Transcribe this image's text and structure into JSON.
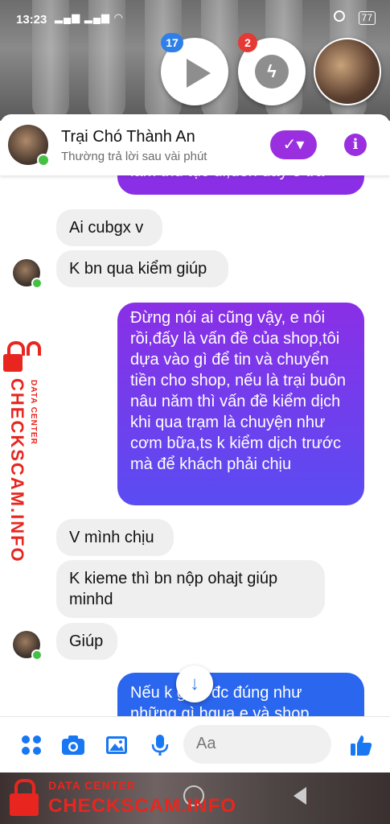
{
  "status_bar": {
    "time": "13:23",
    "battery": "77"
  },
  "chat_heads": {
    "video_badge": "17",
    "messenger_badge": "2"
  },
  "header": {
    "name": "Trại Chó Thành An",
    "subtitle": "Thường trả lời sau vài phút",
    "check_icon": "✓▾",
    "info_icon": "i"
  },
  "messages": [
    {
      "side": "out",
      "text": "làm thủ tục đi,đến đây e trả"
    },
    {
      "side": "in",
      "text": "Ai cubgx v"
    },
    {
      "side": "in",
      "text": "K bn qua kiểm giúp"
    },
    {
      "side": "out",
      "text": "Đừng nói ai cũng vậy, e nói rồi,đấy là vấn đề của shop,tôi dựa vào gì để tin và chuyển tiền cho shop,  nếu là trại buôn nâu năm thì vấn đề kiểm dịch khi qua trạm là chuyện như cơm bữa,ts k kiểm dịch trước mà để khách phải chịu"
    },
    {
      "side": "in",
      "text": "V mình chịu"
    },
    {
      "side": "in",
      "text": "K kieme thì bn nộp ohajt giúp minhd"
    },
    {
      "side": "in",
      "text": "Giúp"
    },
    {
      "side": "out",
      "text": "Nếu k giao đc đúng như những gì hqua e và shop"
    }
  ],
  "composer": {
    "placeholder": "Aa",
    "icons": [
      "apps-icon",
      "camera-icon",
      "image-icon",
      "mic-icon",
      "emoji-icon",
      "thumbs-up-icon"
    ]
  },
  "watermark": {
    "small": "DATA CENTER",
    "big": "CHECKSCAM.INFO"
  },
  "colors": {
    "accent_purple": "#9a2fe0",
    "bubble_gradient_top": "#8a2fe6",
    "bubble_gradient_bottom": "#1f6ff0",
    "messenger_blue": "#1877f2",
    "watermark_red": "#e8261f"
  }
}
